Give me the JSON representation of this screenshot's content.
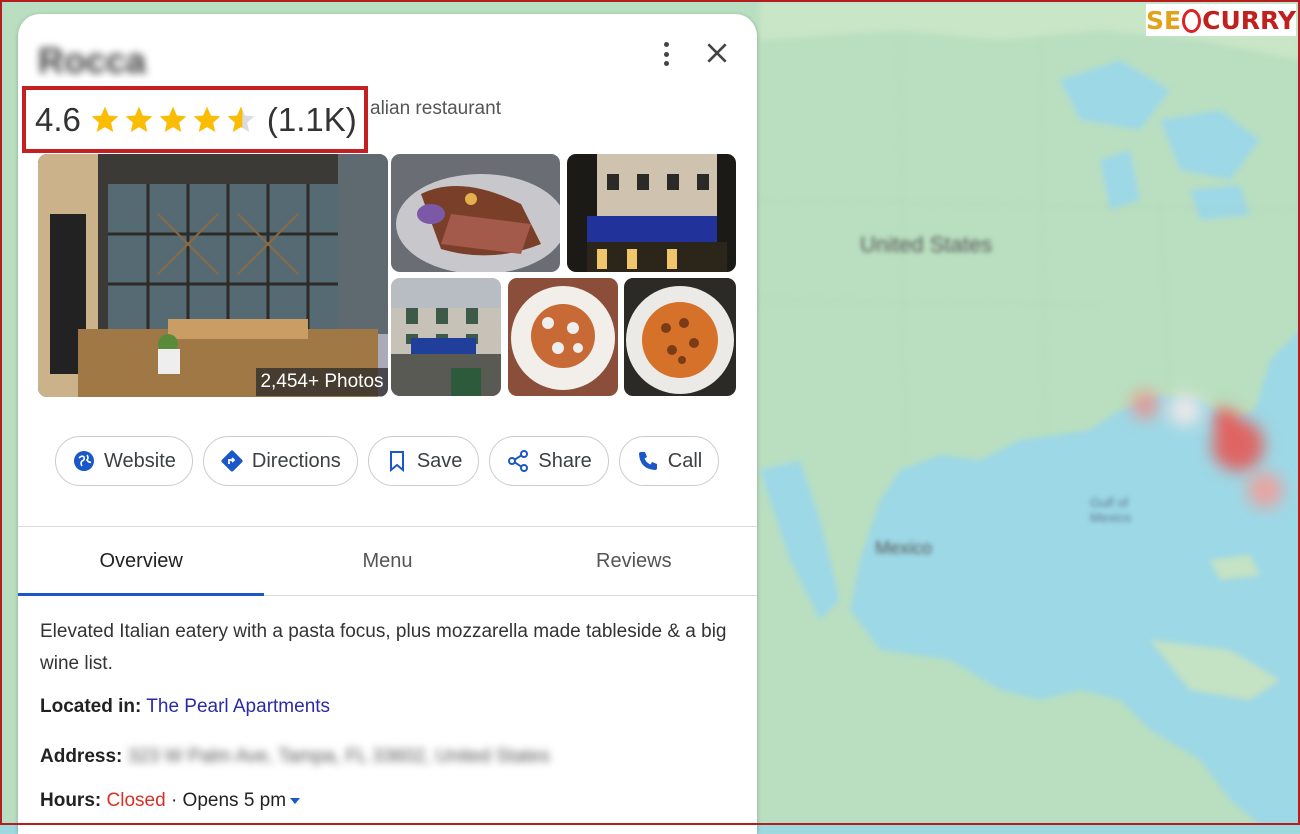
{
  "brand": {
    "logo_part1": "SE",
    "logo_part2": "CURRY"
  },
  "place": {
    "name": "Rocca",
    "category": "alian restaurant",
    "rating": "4.6",
    "reviews_count": "(1.1K)",
    "stars_value": 4.6,
    "photos_label": "2,454+ Photos"
  },
  "actions": [
    {
      "label": "Website",
      "icon": "globe-icon"
    },
    {
      "label": "Directions",
      "icon": "directions-icon"
    },
    {
      "label": "Save",
      "icon": "bookmark-icon"
    },
    {
      "label": "Share",
      "icon": "share-icon"
    },
    {
      "label": "Call",
      "icon": "phone-icon"
    }
  ],
  "tabs": [
    {
      "label": "Overview",
      "active": true
    },
    {
      "label": "Menu",
      "active": false
    },
    {
      "label": "Reviews",
      "active": false
    }
  ],
  "overview": {
    "description": "Elevated Italian eatery with a pasta focus, plus mozzarella made tableside & a big wine list.",
    "located_label": "Located in:",
    "located_value": "The Pearl Apartments",
    "address_label": "Address:",
    "address_value": "323 W Palm Ave, Tampa, FL 33602, United States",
    "hours_label": "Hours:",
    "hours_status": "Closed",
    "hours_detail": "· Opens 5 pm"
  },
  "map": {
    "labels": [
      "United States",
      "Gulf of Mexico",
      "Mexico"
    ]
  },
  "colors": {
    "accent": "#1a57c9",
    "highlight_box": "#c42021",
    "star": "#fbbc04",
    "closed": "#d93025"
  }
}
